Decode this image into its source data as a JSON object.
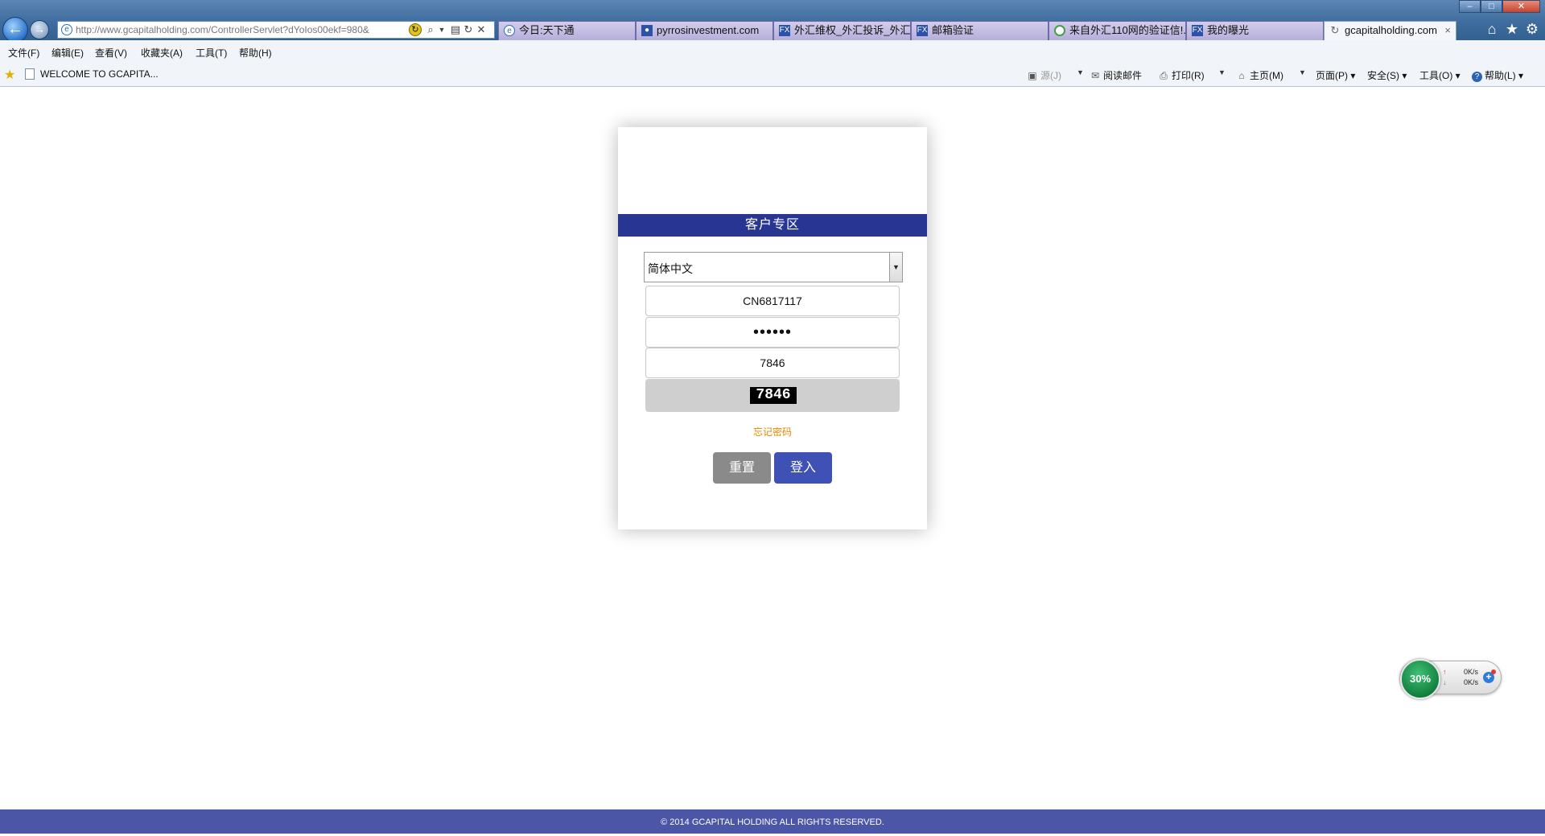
{
  "browser": {
    "address_domain": "gcapitalholding.com",
    "address_url": "http://www.gcapitalholding.com/ControllerServlet?dYoIos00ekf=980&",
    "tabs": [
      {
        "label": "今日:天下通"
      },
      {
        "label": "pyrrosinvestment.com"
      },
      {
        "label": "外汇维权_外汇投诉_外汇..."
      },
      {
        "label": "邮箱验证"
      },
      {
        "label": "来自外汇110网的验证信!..."
      },
      {
        "label": "我的曝光"
      },
      {
        "label": "gcapitalholding.com"
      }
    ],
    "menu": [
      "文件(F)",
      "编辑(E)",
      "查看(V)",
      "收藏夹(A)",
      "工具(T)",
      "帮助(H)"
    ],
    "page_title": "WELCOME TO GCAPITA...",
    "commands": {
      "feeds": "源(J)",
      "read_mail": "阅读邮件",
      "print": "打印(R)",
      "home": "主页(M)",
      "page": "页面(P)",
      "safety": "安全(S)",
      "tools": "工具(O)",
      "help": "帮助(L)"
    }
  },
  "login": {
    "header": "客户专区",
    "language": "简体中文",
    "account": "CN6817117",
    "password_mask": "••••••",
    "captcha_input": "7846",
    "captcha_image_text": "7846",
    "forgot_password": "忘记密码",
    "reset_button": "重置",
    "login_button": "登入"
  },
  "footer": {
    "copyright": "© 2014 GCAPITAL HOLDING ALL RIGHTS RESERVED."
  },
  "speed_widget": {
    "percent": "30%",
    "upload": "0K/s",
    "download": "0K/s"
  }
}
